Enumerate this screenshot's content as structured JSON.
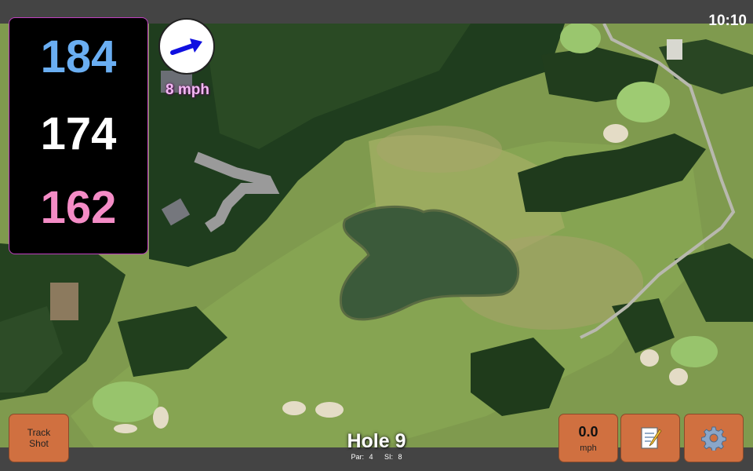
{
  "status": {
    "clock": "10:10"
  },
  "distances": {
    "back": "184",
    "middle": "174",
    "front": "162"
  },
  "wind": {
    "speed": "8 mph",
    "icon": "wind-arrow-icon",
    "direction": "east-northeast"
  },
  "hole": {
    "title": "Hole 9",
    "par": "Par: 4",
    "si": "SI: 8"
  },
  "buttons": {
    "track_shot": "Track\nShot",
    "speed_value": "0.0",
    "speed_unit": "mph",
    "notes_icon": "memo-icon",
    "settings_icon": "gear-icon"
  },
  "colors": {
    "back_distance": "#6aaef2",
    "middle_distance": "#ffffff",
    "front_distance": "#f48cc6",
    "button_bg": "#d07040",
    "wind_label": "#f3b8f3"
  }
}
